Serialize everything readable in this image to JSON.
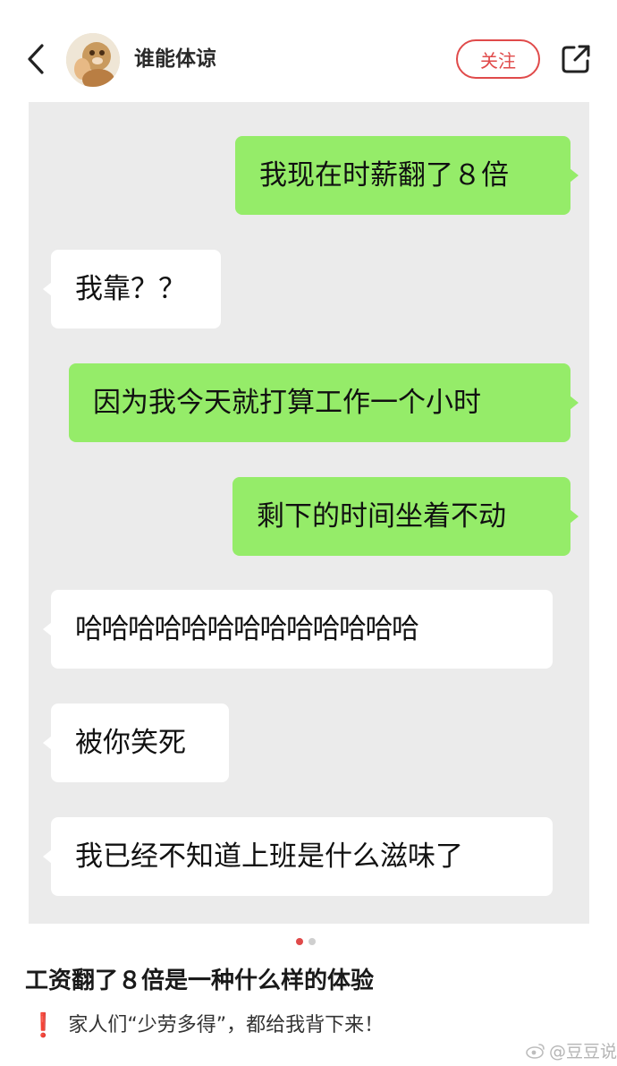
{
  "header": {
    "username": "谁能体谅",
    "follow_label": "关注"
  },
  "icons": {
    "back": "chevron-left-icon",
    "share": "share-external-icon",
    "avatar": "avatar-image",
    "weibo": "weibo-logo-icon"
  },
  "chat": {
    "messages": [
      {
        "side": "sent",
        "text": "我现在时薪翻了８倍"
      },
      {
        "side": "received",
        "text": "我靠？？"
      },
      {
        "side": "sent",
        "text": "因为我今天就打算工作一个小时"
      },
      {
        "side": "sent",
        "text": "剩下的时间坐着不动"
      },
      {
        "side": "received",
        "text": "哈哈哈哈哈哈哈哈哈哈哈哈哈"
      },
      {
        "side": "received",
        "text": "被你笑死"
      },
      {
        "side": "received",
        "text": "我已经不知道上班是什么滋味了"
      }
    ]
  },
  "pager": {
    "current": 1,
    "total": 2
  },
  "post": {
    "title": "工资翻了８倍是一种什么样的体验",
    "exclamation": "❗",
    "body": "家人们“少劳多得”，都给我背下来！"
  },
  "watermark": {
    "text": "@豆豆说"
  },
  "colors": {
    "accent": "#e04a4a",
    "sent_bubble": "#95ec69",
    "received_bubble": "#ffffff",
    "chat_background": "#ebebeb"
  }
}
